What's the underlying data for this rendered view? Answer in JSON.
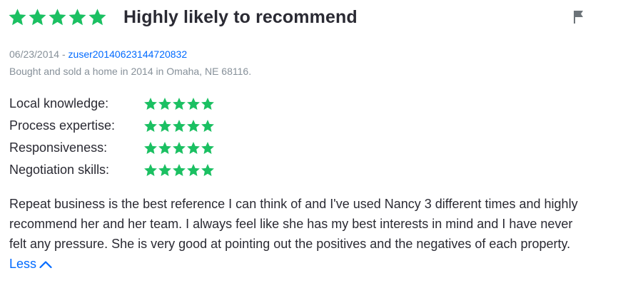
{
  "colors": {
    "star": "#1bc062",
    "link": "#006aff",
    "muted": "#869099",
    "text": "#2a2a33",
    "flag": "#6d7479"
  },
  "review": {
    "overall_rating": 5,
    "title": "Highly likely to recommend",
    "date": "06/23/2014",
    "separator": " - ",
    "author": "zuser20140623144720832",
    "transaction": "Bought and sold a home in 2014 in Omaha, NE 68116.",
    "flag_icon": "flag-icon",
    "ratings": [
      {
        "label": "Local knowledge:",
        "stars": 5
      },
      {
        "label": "Process expertise:",
        "stars": 5
      },
      {
        "label": "Responsiveness:",
        "stars": 5
      },
      {
        "label": "Negotiation skills:",
        "stars": 5
      }
    ],
    "body": "Repeat business is the best reference I can think of and I've used Nancy 3 different times and highly recommend her and her team.  I always feel like she has my best interests in mind and I have never felt any pressure.  She is very good at pointing out the positives and the negatives of each property.",
    "less_label": "Less",
    "less_icon": "chevron-up-icon"
  }
}
